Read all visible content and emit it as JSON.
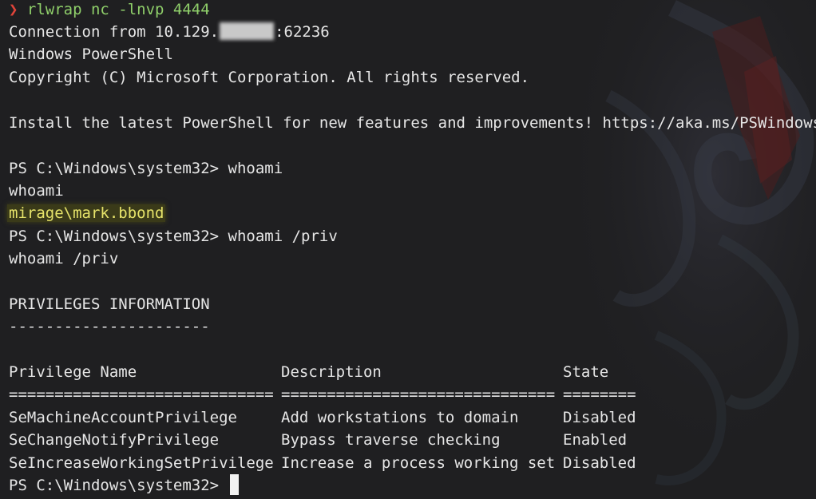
{
  "terminal": {
    "start_prompt_symbol": "❯",
    "start_command": "rlwrap nc -lnvp 4444",
    "connection_prefix": "Connection from 10.129.",
    "connection_suffix": ":62236",
    "banner_title": "Windows PowerShell",
    "banner_copyright": "Copyright (C) Microsoft Corporation. All rights reserved.",
    "banner_install": "Install the latest PowerShell for new features and improvements! https://aka.ms/PSWindows",
    "ps_prompt": "PS C:\\Windows\\system32> ",
    "cmd1": "whoami",
    "cmd1_echo": "whoami",
    "whoami_output": "mirage\\mark.bbond",
    "cmd2": "whoami /priv",
    "cmd2_echo": "whoami /priv",
    "priv_header": "PRIVILEGES INFORMATION",
    "priv_header_underline": "----------------------",
    "table": {
      "columns": [
        "Privilege Name",
        "Description",
        "State"
      ],
      "separators": [
        "=============================",
        "==============================",
        "========"
      ],
      "rows": [
        {
          "name": "SeMachineAccountPrivilege",
          "description": "Add workstations to domain",
          "state": "Disabled"
        },
        {
          "name": "SeChangeNotifyPrivilege",
          "description": "Bypass traverse checking",
          "state": "Enabled"
        },
        {
          "name": "SeIncreaseWorkingSetPrivilege",
          "description": "Increase a process working set",
          "state": "Disabled"
        }
      ]
    },
    "final_prompt": "PS C:\\Windows\\system32> "
  },
  "colors": {
    "background": "#1f1f21",
    "text": "#e6e6e6",
    "prompt_symbol": "#e0443a",
    "start_command": "#8fcf6a",
    "highlight_text": "#e6e36a"
  }
}
